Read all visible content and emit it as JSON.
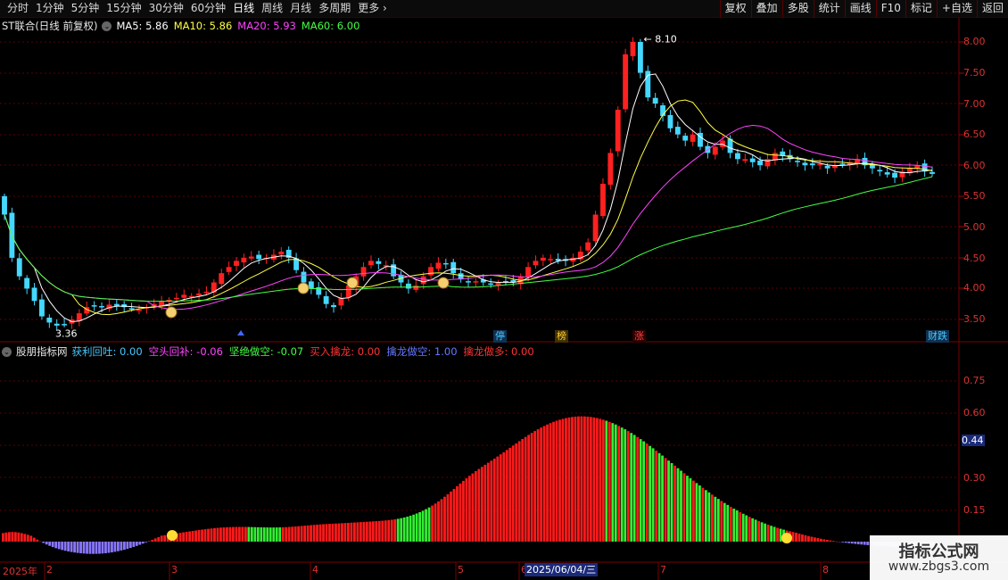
{
  "toolbar": {
    "tabs": [
      "分时",
      "1分钟",
      "5分钟",
      "15分钟",
      "30分钟",
      "60分钟",
      "日线",
      "周线",
      "月线",
      "多周期",
      "更多"
    ],
    "active_tab": "日线",
    "more_arrow": "›",
    "actions": [
      "复权",
      "叠加",
      "多股",
      "统计",
      "画线",
      "F10",
      "标记",
      "+自选",
      "返回"
    ]
  },
  "main_chart": {
    "stock_name": "ST联合(日线 前复权)",
    "ma_legend": [
      {
        "label": "MA5: 5.86",
        "color": "#ffffff"
      },
      {
        "label": "MA10: 5.86",
        "color": "#ffff44"
      },
      {
        "label": "MA20: 5.93",
        "color": "#ff44ff"
      },
      {
        "label": "MA60: 6.00",
        "color": "#44ff44"
      }
    ],
    "price_axis": [
      "8.00",
      "7.50",
      "7.00",
      "6.50",
      "6.00",
      "5.50",
      "5.00",
      "4.50",
      "4.00",
      "3.50"
    ],
    "high_label": "8.10",
    "low_label": "3.36",
    "event_tags": [
      {
        "text": "停",
        "color": "#44c8ff",
        "bg": "#103050"
      },
      {
        "text": "榜",
        "color": "#ffcc33",
        "bg": "#403000"
      },
      {
        "text": "涨",
        "color": "#ff4444",
        "bg": "#300000"
      },
      {
        "text": "财跌",
        "color": "#44c8ff",
        "bg": "#103050"
      }
    ]
  },
  "indicator": {
    "name": "股朋指标网",
    "items": [
      {
        "label": "获利回吐: 0.00",
        "color": "#44c8ff"
      },
      {
        "label": "空头回补: -0.06",
        "color": "#ff44ff"
      },
      {
        "label": "坚绝做空: -0.07",
        "color": "#44ff44"
      },
      {
        "label": "买入擒龙: 0.00",
        "color": "#ff3333"
      },
      {
        "label": "擒龙做空: 1.00",
        "color": "#6677ff"
      },
      {
        "label": "擒龙做多: 0.00",
        "color": "#ff3333"
      }
    ],
    "axis": [
      "0.75",
      "0.60",
      "0.44",
      "0.30",
      "0.15"
    ],
    "current_value": "0.44"
  },
  "time_axis": {
    "year_label": "2025年",
    "months": [
      "2",
      "3",
      "4",
      "5",
      "6",
      "7",
      "8"
    ],
    "cursor_date": "2025/06/04/三"
  },
  "watermark": {
    "title": "指标公式网",
    "url": "www.zbgs3.com"
  },
  "colors": {
    "up": "#ff2020",
    "down": "#44d8ff",
    "grid": "#5a0000",
    "axis_text": "#d33333"
  },
  "chart_data": {
    "type": "candlestick",
    "price_range": [
      3.3,
      8.2
    ],
    "candles_note": "daily OHLC approximated from chart",
    "closes": [
      5.2,
      4.5,
      4.2,
      4.0,
      3.8,
      3.55,
      3.45,
      3.4,
      3.42,
      3.5,
      3.6,
      3.7,
      3.72,
      3.7,
      3.74,
      3.72,
      3.7,
      3.68,
      3.66,
      3.7,
      3.75,
      3.8,
      3.82,
      3.85,
      3.9,
      3.88,
      3.92,
      3.95,
      4.1,
      4.25,
      4.35,
      4.45,
      4.5,
      4.52,
      4.48,
      4.5,
      4.55,
      4.6,
      4.5,
      4.3,
      4.1,
      4.0,
      3.9,
      3.75,
      3.7,
      3.85,
      4.05,
      4.2,
      4.35,
      4.45,
      4.4,
      4.38,
      4.2,
      4.1,
      4.0,
      4.05,
      4.2,
      4.35,
      4.42,
      4.4,
      4.25,
      4.15,
      4.1,
      4.12,
      4.1,
      4.08,
      4.1,
      4.12,
      4.1,
      4.2,
      4.35,
      4.45,
      4.5,
      4.48,
      4.45,
      4.45,
      4.5,
      4.6,
      4.75,
      5.2,
      5.7,
      6.2,
      6.9,
      7.8,
      8.0,
      7.5,
      7.1,
      7.0,
      6.8,
      6.6,
      6.5,
      6.4,
      6.5,
      6.3,
      6.2,
      6.3,
      6.4,
      6.2,
      6.1,
      6.1,
      6.05,
      6.0,
      6.1,
      6.2,
      6.15,
      6.1,
      6.05,
      6.0,
      6.0,
      6.02,
      5.95,
      6.0,
      6.02,
      6.05,
      6.1,
      6.0,
      5.95,
      5.9,
      5.85,
      5.8,
      5.9,
      5.95,
      6.0,
      5.9,
      5.86
    ],
    "ma_values": {
      "MA5": 5.86,
      "MA10": 5.86,
      "MA20": 5.93,
      "MA60": 6.0
    },
    "indicator_series": "red/green bars oscillation peaking ~0.78 in June"
  }
}
